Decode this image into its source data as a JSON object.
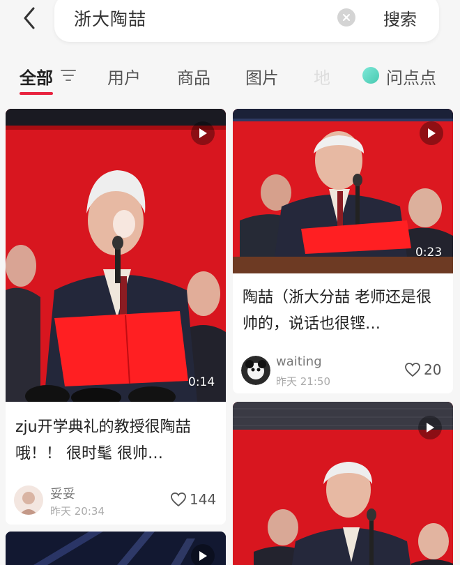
{
  "search": {
    "query": "浙大陶喆",
    "button_label": "搜索"
  },
  "tabs": [
    {
      "label": "全部",
      "active": true
    },
    {
      "label": "用户"
    },
    {
      "label": "商品"
    },
    {
      "label": "图片"
    },
    {
      "label": "地"
    },
    {
      "label": "问点点"
    }
  ],
  "icons": {
    "back": "chevron-left-icon",
    "clear": "clear-icon",
    "filter": "filter-icon",
    "play": "play-icon",
    "heart": "heart-icon"
  },
  "colors": {
    "accent": "#e8233f",
    "stage_red": "#d8161f"
  },
  "cards": [
    {
      "duration": "0:14",
      "title": "zju开学典礼的教授很陶喆哦！！ 很时髦 很帅…",
      "author": "妥妥",
      "time": "昨天 20:34",
      "likes": "144"
    },
    {
      "duration": "0:23",
      "title": "陶喆（浙大分喆 老师还是很帅的，说话也很铿…",
      "author": "waiting",
      "time": "昨天 21:50",
      "likes": "20"
    },
    {
      "duration": ""
    },
    {
      "duration": ""
    }
  ]
}
